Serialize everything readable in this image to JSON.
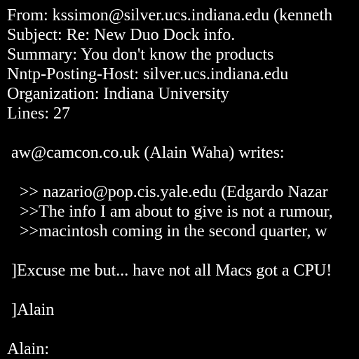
{
  "document": {
    "background": "#000000",
    "text_color": "#ffffff",
    "lines": [
      "From: kssimon@silver.ucs.indiana.edu (kenneth",
      "Subject: Re: New Duo Dock info.",
      "Summary: You don't know the products",
      "Nntp-Posting-Host: silver.ucs.indiana.edu",
      "Organization: Indiana University",
      "Lines: 27",
      "",
      " aw@camcon.co.uk (Alain Waha) writes:",
      "",
      "   >> nazario@pop.cis.yale.edu (Edgardo Nazar",
      "   >>The info I am about to give is not a rumour,",
      "   >>macintosh coming in the second quarter, w",
      "",
      " ]Excuse me but... have not all Macs got a CPU!",
      "",
      " ]Alain",
      "",
      "Alain:"
    ]
  }
}
